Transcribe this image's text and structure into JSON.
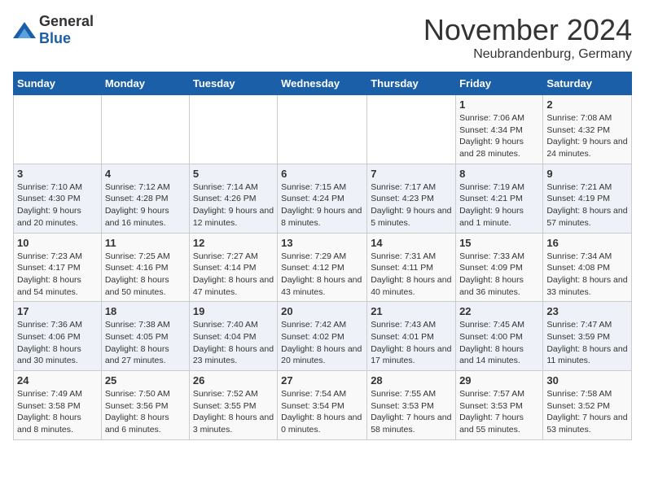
{
  "header": {
    "logo_general": "General",
    "logo_blue": "Blue",
    "month_title": "November 2024",
    "location": "Neubrandenburg, Germany"
  },
  "days_of_week": [
    "Sunday",
    "Monday",
    "Tuesday",
    "Wednesday",
    "Thursday",
    "Friday",
    "Saturday"
  ],
  "weeks": [
    [
      {
        "day": "",
        "info": ""
      },
      {
        "day": "",
        "info": ""
      },
      {
        "day": "",
        "info": ""
      },
      {
        "day": "",
        "info": ""
      },
      {
        "day": "",
        "info": ""
      },
      {
        "day": "1",
        "info": "Sunrise: 7:06 AM\nSunset: 4:34 PM\nDaylight: 9 hours and 28 minutes."
      },
      {
        "day": "2",
        "info": "Sunrise: 7:08 AM\nSunset: 4:32 PM\nDaylight: 9 hours and 24 minutes."
      }
    ],
    [
      {
        "day": "3",
        "info": "Sunrise: 7:10 AM\nSunset: 4:30 PM\nDaylight: 9 hours and 20 minutes."
      },
      {
        "day": "4",
        "info": "Sunrise: 7:12 AM\nSunset: 4:28 PM\nDaylight: 9 hours and 16 minutes."
      },
      {
        "day": "5",
        "info": "Sunrise: 7:14 AM\nSunset: 4:26 PM\nDaylight: 9 hours and 12 minutes."
      },
      {
        "day": "6",
        "info": "Sunrise: 7:15 AM\nSunset: 4:24 PM\nDaylight: 9 hours and 8 minutes."
      },
      {
        "day": "7",
        "info": "Sunrise: 7:17 AM\nSunset: 4:23 PM\nDaylight: 9 hours and 5 minutes."
      },
      {
        "day": "8",
        "info": "Sunrise: 7:19 AM\nSunset: 4:21 PM\nDaylight: 9 hours and 1 minute."
      },
      {
        "day": "9",
        "info": "Sunrise: 7:21 AM\nSunset: 4:19 PM\nDaylight: 8 hours and 57 minutes."
      }
    ],
    [
      {
        "day": "10",
        "info": "Sunrise: 7:23 AM\nSunset: 4:17 PM\nDaylight: 8 hours and 54 minutes."
      },
      {
        "day": "11",
        "info": "Sunrise: 7:25 AM\nSunset: 4:16 PM\nDaylight: 8 hours and 50 minutes."
      },
      {
        "day": "12",
        "info": "Sunrise: 7:27 AM\nSunset: 4:14 PM\nDaylight: 8 hours and 47 minutes."
      },
      {
        "day": "13",
        "info": "Sunrise: 7:29 AM\nSunset: 4:12 PM\nDaylight: 8 hours and 43 minutes."
      },
      {
        "day": "14",
        "info": "Sunrise: 7:31 AM\nSunset: 4:11 PM\nDaylight: 8 hours and 40 minutes."
      },
      {
        "day": "15",
        "info": "Sunrise: 7:33 AM\nSunset: 4:09 PM\nDaylight: 8 hours and 36 minutes."
      },
      {
        "day": "16",
        "info": "Sunrise: 7:34 AM\nSunset: 4:08 PM\nDaylight: 8 hours and 33 minutes."
      }
    ],
    [
      {
        "day": "17",
        "info": "Sunrise: 7:36 AM\nSunset: 4:06 PM\nDaylight: 8 hours and 30 minutes."
      },
      {
        "day": "18",
        "info": "Sunrise: 7:38 AM\nSunset: 4:05 PM\nDaylight: 8 hours and 27 minutes."
      },
      {
        "day": "19",
        "info": "Sunrise: 7:40 AM\nSunset: 4:04 PM\nDaylight: 8 hours and 23 minutes."
      },
      {
        "day": "20",
        "info": "Sunrise: 7:42 AM\nSunset: 4:02 PM\nDaylight: 8 hours and 20 minutes."
      },
      {
        "day": "21",
        "info": "Sunrise: 7:43 AM\nSunset: 4:01 PM\nDaylight: 8 hours and 17 minutes."
      },
      {
        "day": "22",
        "info": "Sunrise: 7:45 AM\nSunset: 4:00 PM\nDaylight: 8 hours and 14 minutes."
      },
      {
        "day": "23",
        "info": "Sunrise: 7:47 AM\nSunset: 3:59 PM\nDaylight: 8 hours and 11 minutes."
      }
    ],
    [
      {
        "day": "24",
        "info": "Sunrise: 7:49 AM\nSunset: 3:58 PM\nDaylight: 8 hours and 8 minutes."
      },
      {
        "day": "25",
        "info": "Sunrise: 7:50 AM\nSunset: 3:56 PM\nDaylight: 8 hours and 6 minutes."
      },
      {
        "day": "26",
        "info": "Sunrise: 7:52 AM\nSunset: 3:55 PM\nDaylight: 8 hours and 3 minutes."
      },
      {
        "day": "27",
        "info": "Sunrise: 7:54 AM\nSunset: 3:54 PM\nDaylight: 8 hours and 0 minutes."
      },
      {
        "day": "28",
        "info": "Sunrise: 7:55 AM\nSunset: 3:53 PM\nDaylight: 7 hours and 58 minutes."
      },
      {
        "day": "29",
        "info": "Sunrise: 7:57 AM\nSunset: 3:53 PM\nDaylight: 7 hours and 55 minutes."
      },
      {
        "day": "30",
        "info": "Sunrise: 7:58 AM\nSunset: 3:52 PM\nDaylight: 7 hours and 53 minutes."
      }
    ]
  ]
}
